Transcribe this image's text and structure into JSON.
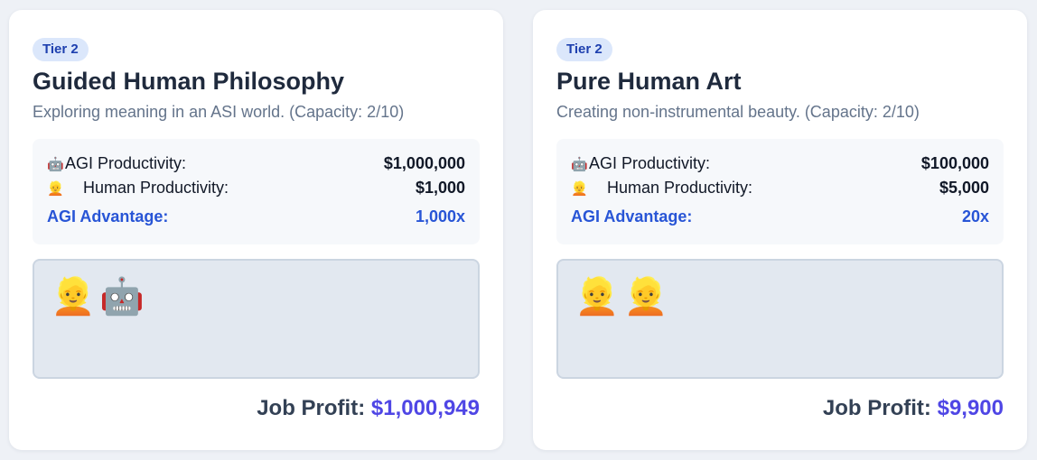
{
  "cards": [
    {
      "tier": "Tier 2",
      "title": "Guided Human Philosophy",
      "description": "Exploring meaning in an ASI world. (Capacity: 2/10)",
      "agi_icon": "🤖",
      "agi_label": "AGI Productivity:",
      "agi_value": "$1,000,000",
      "human_icon": "👱",
      "human_label": "Human Productivity:",
      "human_value": "$1,000",
      "advantage_label": "AGI Advantage:",
      "advantage_value": "1,000x",
      "workers": [
        "👱",
        "🤖"
      ],
      "profit_label": "Job Profit:",
      "profit_value": "$1,000,949"
    },
    {
      "tier": "Tier 2",
      "title": "Pure Human Art",
      "description": "Creating non-instrumental beauty. (Capacity: 2/10)",
      "agi_icon": "🤖",
      "agi_label": "AGI Productivity:",
      "agi_value": "$100,000",
      "human_icon": "👱",
      "human_label": "Human Productivity:",
      "human_value": "$5,000",
      "advantage_label": "AGI Advantage:",
      "advantage_value": "20x",
      "workers": [
        "👱",
        "👱"
      ],
      "profit_label": "Job Profit:",
      "profit_value": "$9,900"
    }
  ],
  "colors": {
    "background": "#eef1f6",
    "badge_bg": "#dbe7fb",
    "badge_text": "#1e40af",
    "advantage": "#2855d6",
    "profit_value": "#4f46e5"
  }
}
